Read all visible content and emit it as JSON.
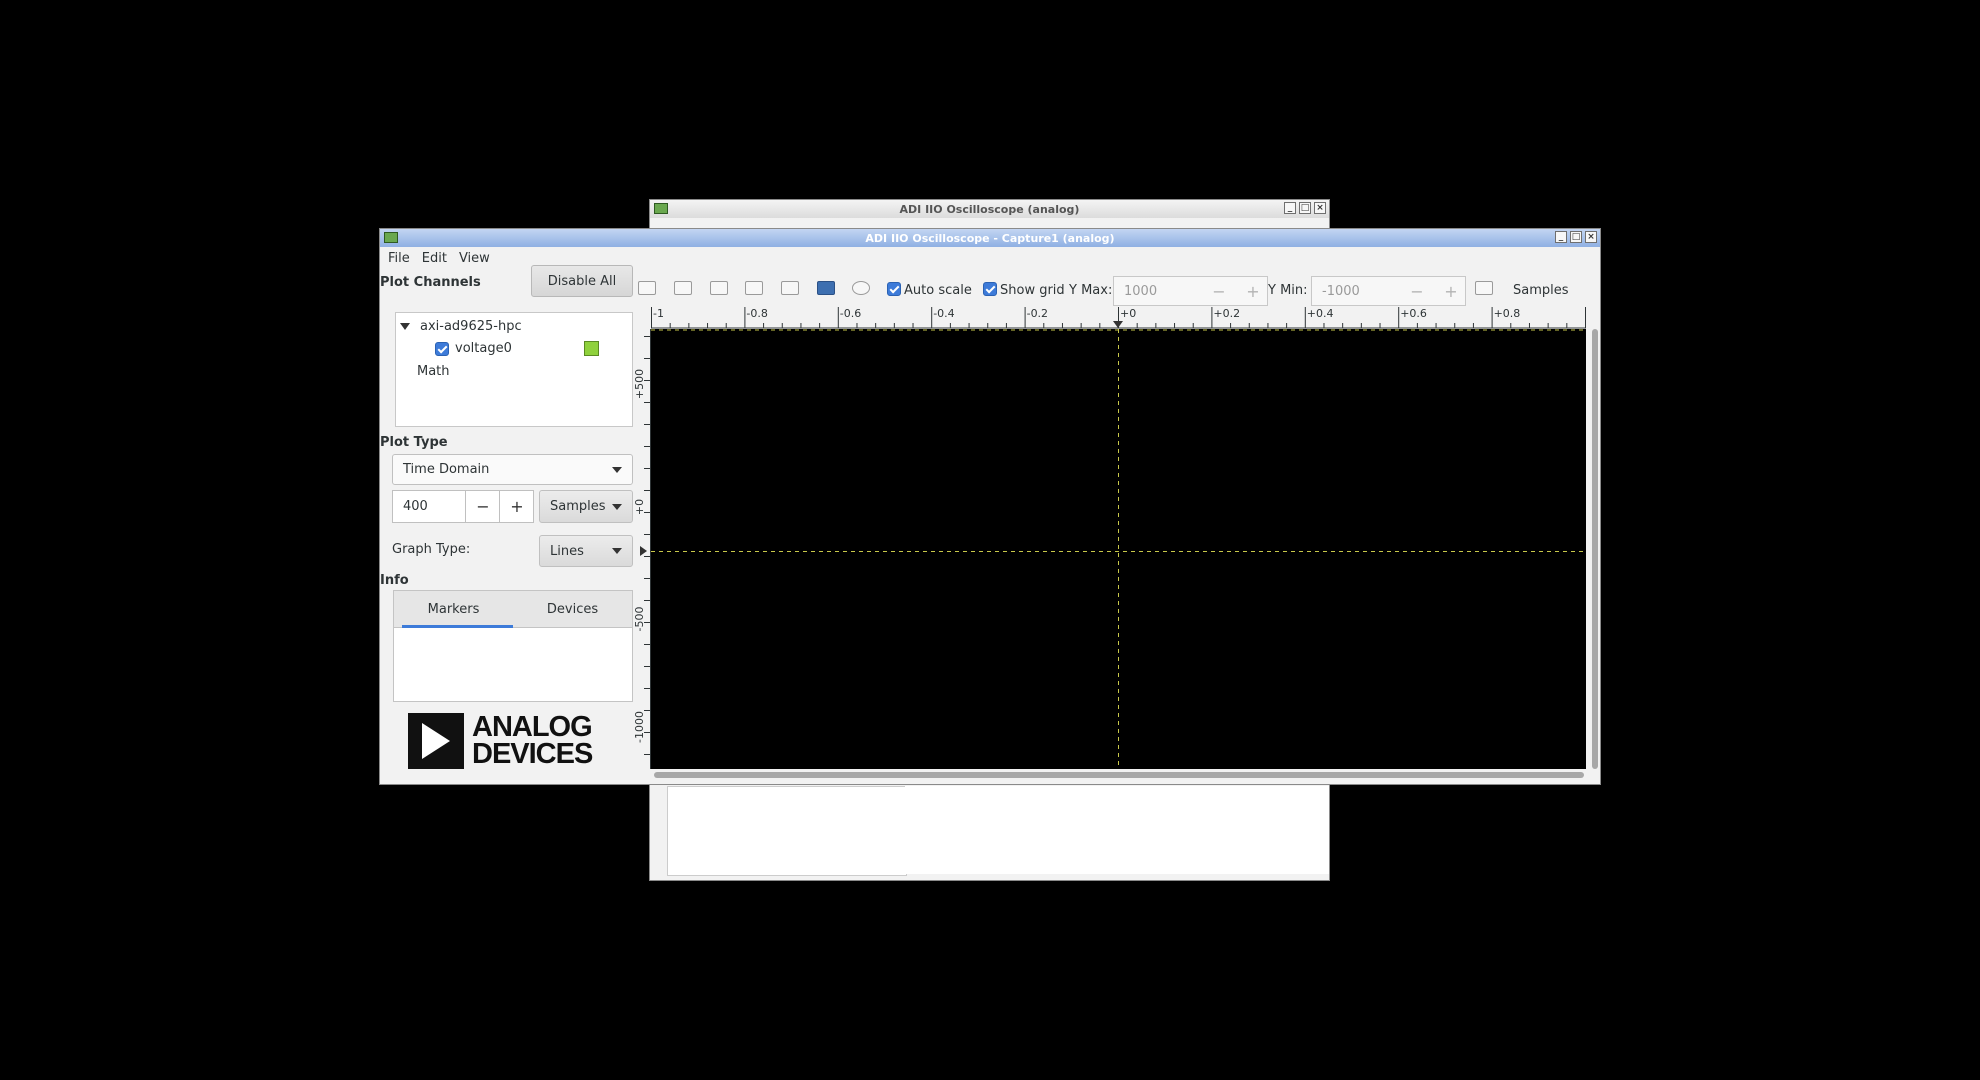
{
  "bg_window": {
    "title": "ADI IIO Oscilloscope (analog)"
  },
  "main_window": {
    "title": "ADI IIO Oscilloscope - Capture1 (analog)"
  },
  "menu": [
    "File",
    "Edit",
    "View"
  ],
  "sidebar": {
    "plot_channels_title": "Plot Channels",
    "disable_all_label": "Disable All",
    "device_name": "axi-ad9625-hpc",
    "channel_name": "voltage0",
    "channel_color": "#8fd13c",
    "math_label": "Math",
    "plot_type_title": "Plot Type",
    "plot_type_value": "Time Domain",
    "samples_value": "400",
    "samples_unit": "Samples",
    "graph_type_label": "Graph Type:",
    "graph_type_value": "Lines",
    "info_title": "Info",
    "tabs": [
      "Markers",
      "Devices"
    ],
    "logo_line1": "ANALOG",
    "logo_line2": "DEVICES"
  },
  "toolbar": {
    "auto_scale_label": "Auto scale",
    "show_grid_label": "Show grid",
    "y_max_label": "Y Max:",
    "y_max_value": "1000",
    "y_min_label": "Y Min:",
    "y_min_value": "-1000",
    "samples_label": "Samples"
  },
  "plot": {
    "x_ticks": [
      "-1",
      "-0.8",
      "-0.6",
      "-0.4",
      "-0.2",
      "+0",
      "+0.2",
      "+0.4",
      "+0.6",
      "+0.8"
    ],
    "y_ticks": [
      "+500",
      "+0",
      "-500",
      "-1000"
    ],
    "grid_color": "#c8c84a"
  }
}
